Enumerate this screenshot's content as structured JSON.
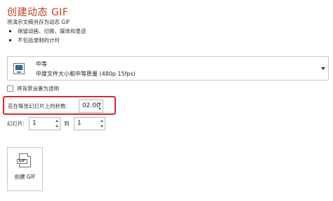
{
  "header": {
    "title": "创建动态 GIF",
    "description": "将演示文稿另存为动态 GIF",
    "bullets": [
      "保留动画、切换、媒体和墨迹",
      "不包括录制的计时"
    ]
  },
  "quality_dropdown": {
    "icon": "monitor-icon",
    "selected_label": "中等",
    "selected_detail": "中度文件大小和中等质量 (480p 15fps)"
  },
  "transparent_background": {
    "label": "将背景设置为透明",
    "checked": false
  },
  "seconds_per_slide": {
    "label": "花在每张幻灯片上的秒数:",
    "value": "02.00"
  },
  "slide_range": {
    "label": "幻灯片:",
    "from_value": "1",
    "to_label": "到",
    "to_value": "1"
  },
  "create_button": {
    "icon_text": "GIF",
    "label": "创建 GIF"
  },
  "colors": {
    "title": "#c43e1c",
    "highlight_border": "#d42b2b"
  }
}
